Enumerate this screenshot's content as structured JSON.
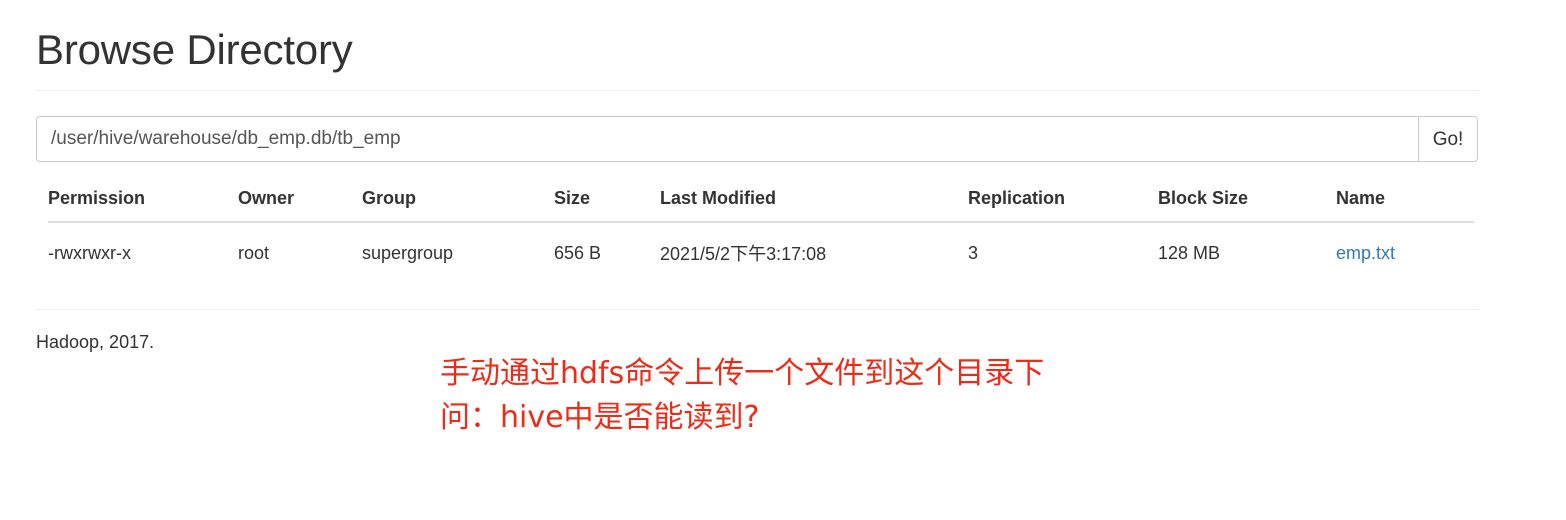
{
  "page": {
    "title": "Browse Directory"
  },
  "path_bar": {
    "value": "/user/hive/warehouse/db_emp.db/tb_emp",
    "placeholder": "Enter a path",
    "go_label": "Go!"
  },
  "table": {
    "headers": [
      "Permission",
      "Owner",
      "Group",
      "Size",
      "Last Modified",
      "Replication",
      "Block Size",
      "Name"
    ],
    "rows": [
      {
        "permission": "-rwxrwxr-x",
        "owner": "root",
        "group": "supergroup",
        "size": "656 B",
        "last_modified": "2021/5/2下午3:17:08",
        "replication": "3",
        "block_size": "128 MB",
        "name": "emp.txt"
      }
    ]
  },
  "footer": {
    "text": "Hadoop, 2017."
  },
  "annotation": {
    "line1": "手动通过hdfs命令上传一个文件到这个目录下",
    "line2": "问：hive中是否能读到?",
    "color": "#ee2b16"
  }
}
